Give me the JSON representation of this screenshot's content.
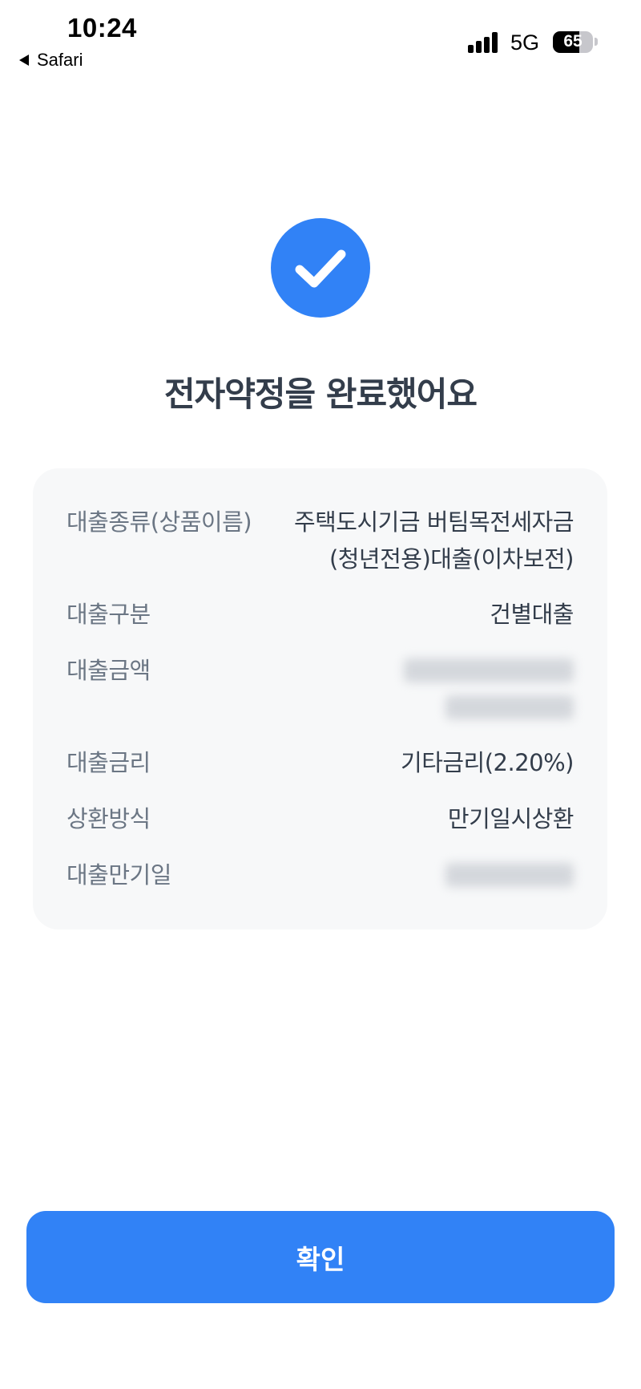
{
  "status_bar": {
    "time": "10:24",
    "back_app": "Safari",
    "network": "5G",
    "battery_level": "65"
  },
  "headline": "전자약정을 완료했어요",
  "loan_details": {
    "rows": [
      {
        "label": "대출종류(상품이름)",
        "value_line1": "주택도시기금 버팀목전세자금",
        "value_line2": "(청년전용)대출(이차보전)"
      },
      {
        "label": "대출구분",
        "value": "건별대출"
      },
      {
        "label": "대출금액",
        "value": ""
      },
      {
        "label": "대출금리",
        "value": "기타금리(2.20%)"
      },
      {
        "label": "상환방식",
        "value": "만기일시상환"
      },
      {
        "label": "대출만기일",
        "value": ""
      }
    ]
  },
  "confirm_button": "확인",
  "colors": {
    "accent": "#3182f6",
    "card_background": "#f7f8f9",
    "label_text": "#6b7684",
    "value_text": "#333d4b"
  },
  "icons": {
    "success": "check-circle-icon",
    "signal": "signal-bars-icon",
    "back": "back-triangle-icon",
    "battery": "battery-icon"
  }
}
